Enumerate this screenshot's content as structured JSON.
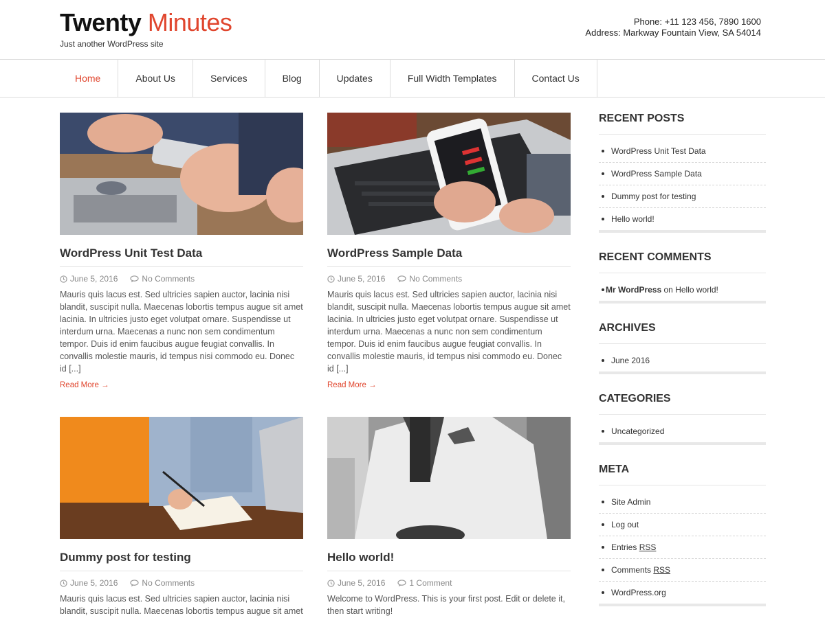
{
  "site": {
    "title_main": "Twenty",
    "title_accent": "Minutes",
    "tagline": "Just another WordPress site",
    "phone": "Phone: +11 123 456, 7890 1600",
    "address": "Address: Markway Fountain View, SA 54014",
    "accent_color": "#e0452d"
  },
  "nav": {
    "items": [
      {
        "label": "Home",
        "active": true
      },
      {
        "label": "About Us"
      },
      {
        "label": "Services"
      },
      {
        "label": "Blog"
      },
      {
        "label": "Updates"
      },
      {
        "label": "Full Width Templates"
      },
      {
        "label": "Contact Us"
      }
    ]
  },
  "posts": [
    {
      "title": "WordPress Unit Test Data",
      "date": "June 5, 2016",
      "comments": "No Comments",
      "excerpt": "Mauris quis lacus est. Sed ultricies sapien auctor, lacinia nisi blandit, suscipit nulla. Maecenas lobortis tempus augue sit amet lacinia. In ultricies justo eget volutpat ornare. Suspendisse ut interdum urna. Maecenas a nunc non sem condimentum tempor. Duis id enim faucibus augue feugiat convallis. In convallis molestie mauris, id tempus nisi commodo eu. Donec id [...]",
      "read_more": "Read More →"
    },
    {
      "title": "WordPress Sample Data",
      "date": "June 5, 2016",
      "comments": "No Comments",
      "excerpt": "Mauris quis lacus est. Sed ultricies sapien auctor, lacinia nisi blandit, suscipit nulla. Maecenas lobortis tempus augue sit amet lacinia. In ultricies justo eget volutpat ornare. Suspendisse ut interdum urna. Maecenas a nunc non sem condimentum tempor. Duis id enim faucibus augue feugiat convallis. In convallis molestie mauris, id tempus nisi commodo eu. Donec id [...]",
      "read_more": "Read More →"
    },
    {
      "title": "Dummy post for testing",
      "date": "June 5, 2016",
      "comments": "No Comments",
      "excerpt": "Mauris quis lacus est. Sed ultricies sapien auctor, lacinia nisi blandit, suscipit nulla. Maecenas lobortis tempus augue sit amet"
    },
    {
      "title": "Hello world!",
      "date": "June 5, 2016",
      "comments": "1 Comment",
      "excerpt": "Welcome to WordPress. This is your first post. Edit or delete it, then start writing!"
    }
  ],
  "sidebar": {
    "recent_posts": {
      "title": "RECENT POSTS",
      "items": [
        "WordPress Unit Test Data",
        "WordPress Sample Data",
        "Dummy post for testing",
        "Hello world!"
      ]
    },
    "recent_comments": {
      "title": "RECENT COMMENTS",
      "author": "Mr WordPress",
      "on": "on",
      "post": "Hello world!"
    },
    "archives": {
      "title": "ARCHIVES",
      "items": [
        "June 2016"
      ]
    },
    "categories": {
      "title": "CATEGORIES",
      "items": [
        "Uncategorized"
      ]
    },
    "meta": {
      "title": "META",
      "site_admin": "Site Admin",
      "log_out": "Log out",
      "entries_prefix": "Entries",
      "comments_prefix": "Comments",
      "rss": "RSS",
      "wordpress_org": "WordPress.org"
    }
  }
}
